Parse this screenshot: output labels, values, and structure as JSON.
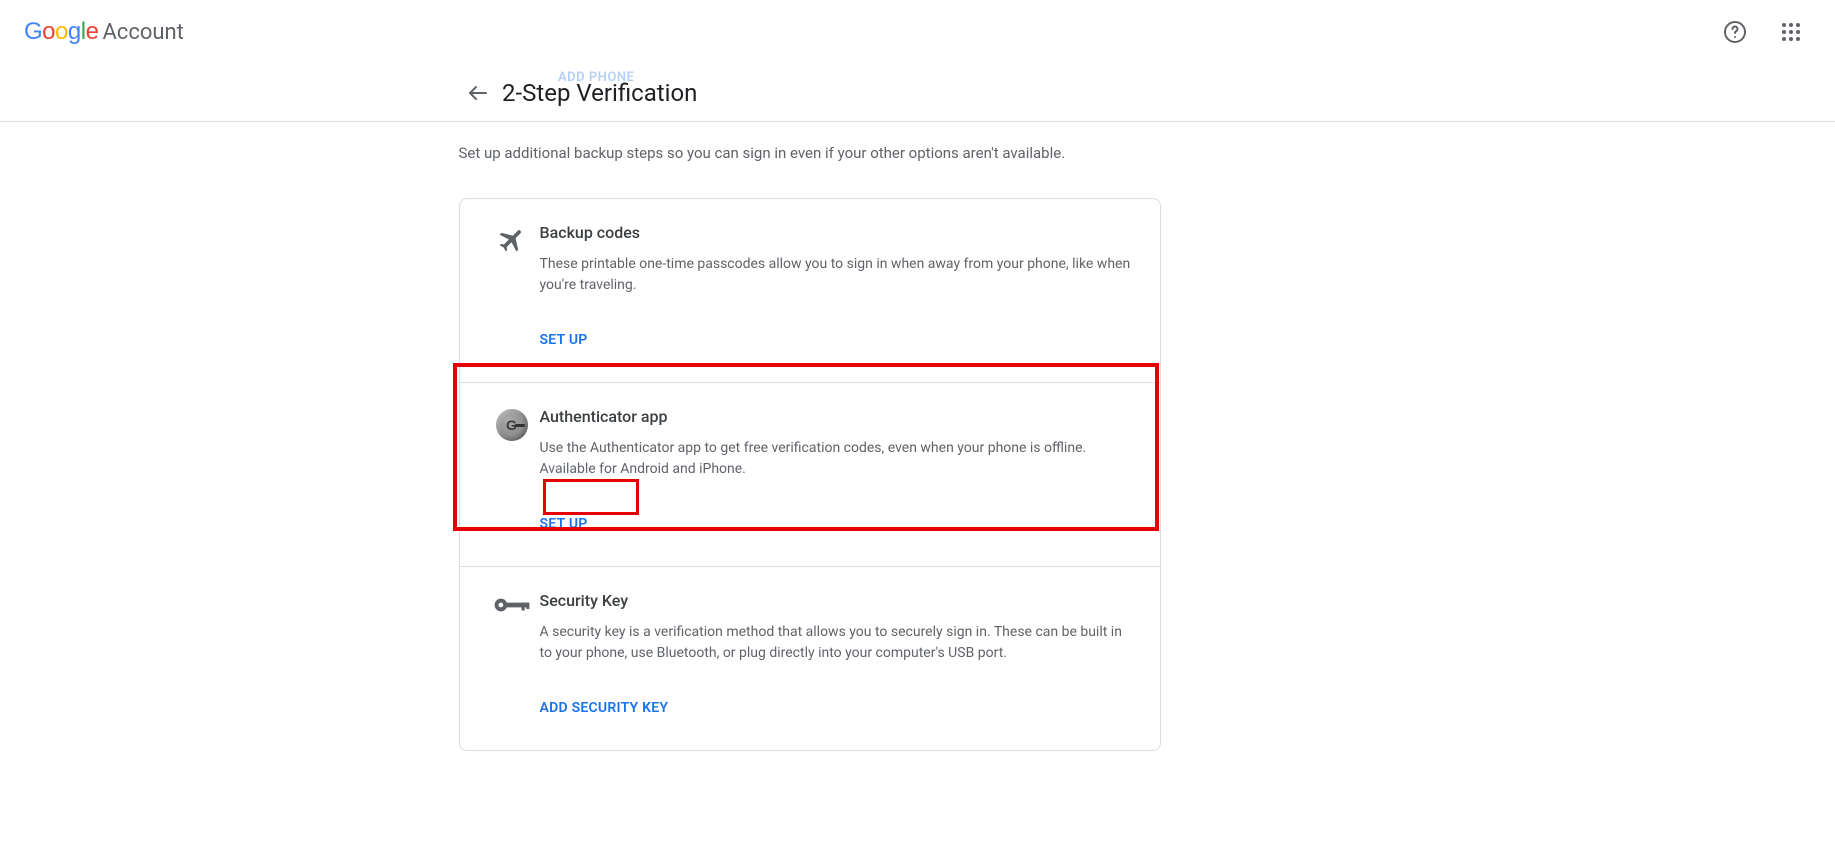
{
  "branding": {
    "product": "Account"
  },
  "ghost_button": "ADD PHONE",
  "page_title": "2-Step Verification",
  "intro_text": "Set up additional backup steps so you can sign in even if your other options aren't available.",
  "sections": {
    "backup_codes": {
      "title": "Backup codes",
      "desc": "These printable one-time passcodes allow you to sign in when away from your phone, like when you're traveling.",
      "action": "SET UP"
    },
    "authenticator": {
      "title": "Authenticator app",
      "desc": "Use the Authenticator app to get free verification codes, even when your phone is offline. Available for Android and iPhone.",
      "action": "SET UP"
    },
    "security_key": {
      "title": "Security Key",
      "desc": "A security key is a verification method that allows you to securely sign in. These can be built in to your phone, use Bluetooth, or plug directly into your computer's USB port.",
      "action": "ADD SECURITY KEY"
    }
  }
}
